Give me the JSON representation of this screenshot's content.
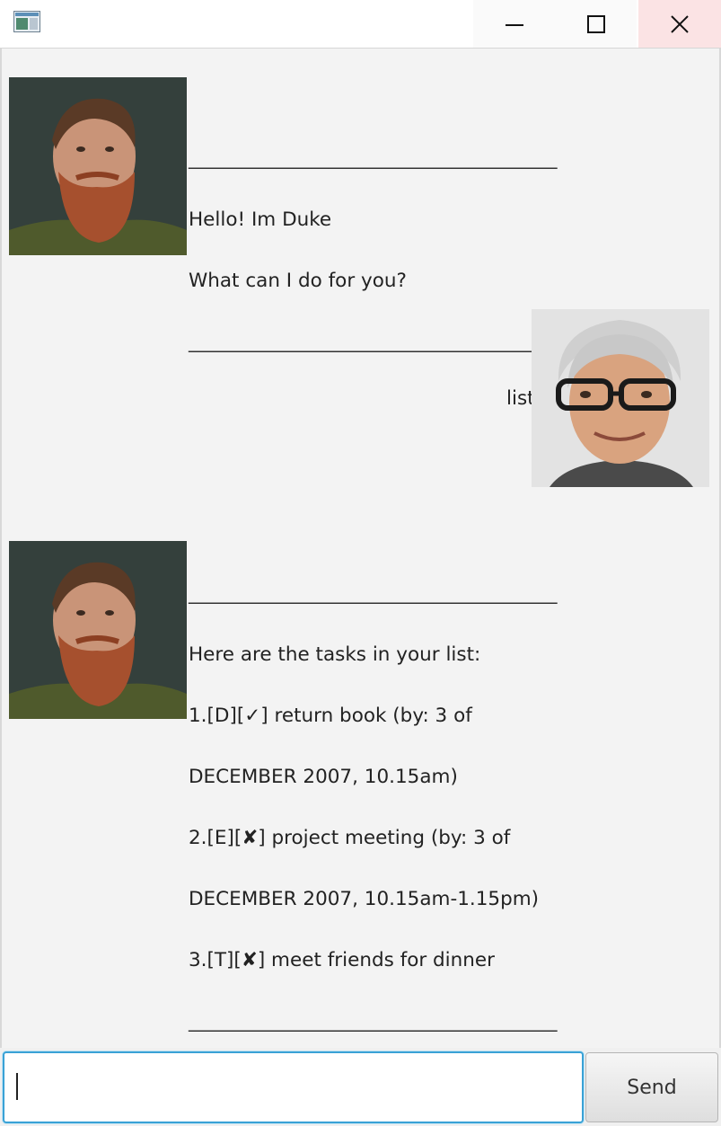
{
  "window": {
    "icons": {
      "app": "app-window-icon",
      "minimize": "minimize-icon",
      "maximize": "maximize-icon",
      "close": "close-icon"
    }
  },
  "messages": [
    {
      "sender": "duke",
      "avatar": "bearded-man-avatar",
      "lines": [
        "__________________________________________",
        "Hello! Im Duke",
        "What can I do for you?",
        "__________________________________________"
      ]
    },
    {
      "sender": "user",
      "avatar": "man-with-glasses-avatar",
      "text": "list"
    },
    {
      "sender": "duke",
      "avatar": "bearded-man-avatar",
      "lines": [
        "__________________________________________",
        "Here are the tasks in your list:",
        "1.[D][✓] return book (by: 3 of",
        "DECEMBER 2007, 10.15am)",
        "2.[E][✘] project meeting (by: 3 of",
        "DECEMBER 2007, 10.15am-1.15pm)",
        "3.[T][✘] meet friends for dinner",
        "__________________________________________"
      ]
    }
  ],
  "input": {
    "value": "",
    "send_label": "Send"
  }
}
